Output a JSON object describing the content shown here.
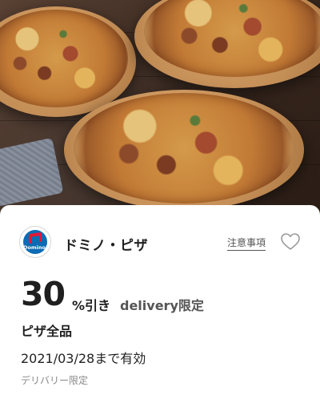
{
  "hero": {
    "image": "pizzas-on-wooden-boards"
  },
  "brand": {
    "logo_text": "Domino's",
    "name": "ドミノ・ピザ",
    "colors": {
      "blue": "#0b6bb5",
      "red": "#e31837"
    }
  },
  "actions": {
    "notice_label": "注意事項",
    "favorite_icon": "heart-outline-icon"
  },
  "offer": {
    "discount_value": "30",
    "discount_suffix": "%引き",
    "discount_tag": "delivery限定",
    "target": "ピザ全品",
    "valid_until": "2021/03/28まで有効",
    "note": "デリバリー限定"
  }
}
